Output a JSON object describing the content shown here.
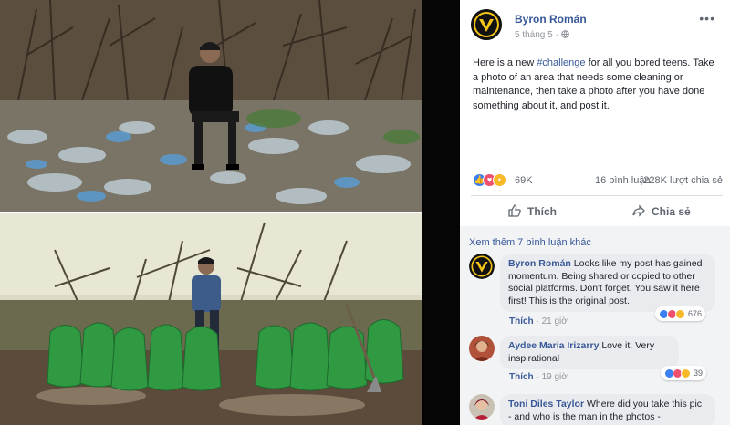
{
  "post": {
    "author": "Byron Román",
    "date": "5 tháng 5",
    "audience_icon": "globe-icon",
    "more_icon": "more-horizontal-icon",
    "text_before": "Here is a new ",
    "hashtag": "#challenge",
    "text_after": " for all you bored teens. Take a photo of an area that needs some cleaning or maintenance, then take a photo after you have done something about it, and post it.",
    "reactions_count": "69K",
    "comments_count": "16 bình luận",
    "shares_count": "228K lượt chia sẻ",
    "like_label": "Thích",
    "share_label": "Chia sẻ"
  },
  "comments": {
    "see_more": "Xem thêm 7 bình luận khác",
    "items": [
      {
        "author": "Byron Román",
        "text": "Looks like my post has gained momentum. Being shared or copied to other social platforms. Don't forget, You saw it here first! This is the original post.",
        "like": "Thích",
        "time": "21 giờ",
        "reactions": "676"
      },
      {
        "author": "Aydee Maria Irizarry",
        "text": "Love it. Very inspirational",
        "like": "Thích",
        "time": "19 giờ",
        "reactions": "39"
      },
      {
        "author": "Toni Diles Taylor",
        "text": "Where did you take this pic - and who is the man in the photos -"
      }
    ]
  },
  "colors": {
    "link": "#385898",
    "like_reaction": "#3b7ff0",
    "love_reaction": "#f0506e",
    "wow_reaction": "#f7b928"
  }
}
